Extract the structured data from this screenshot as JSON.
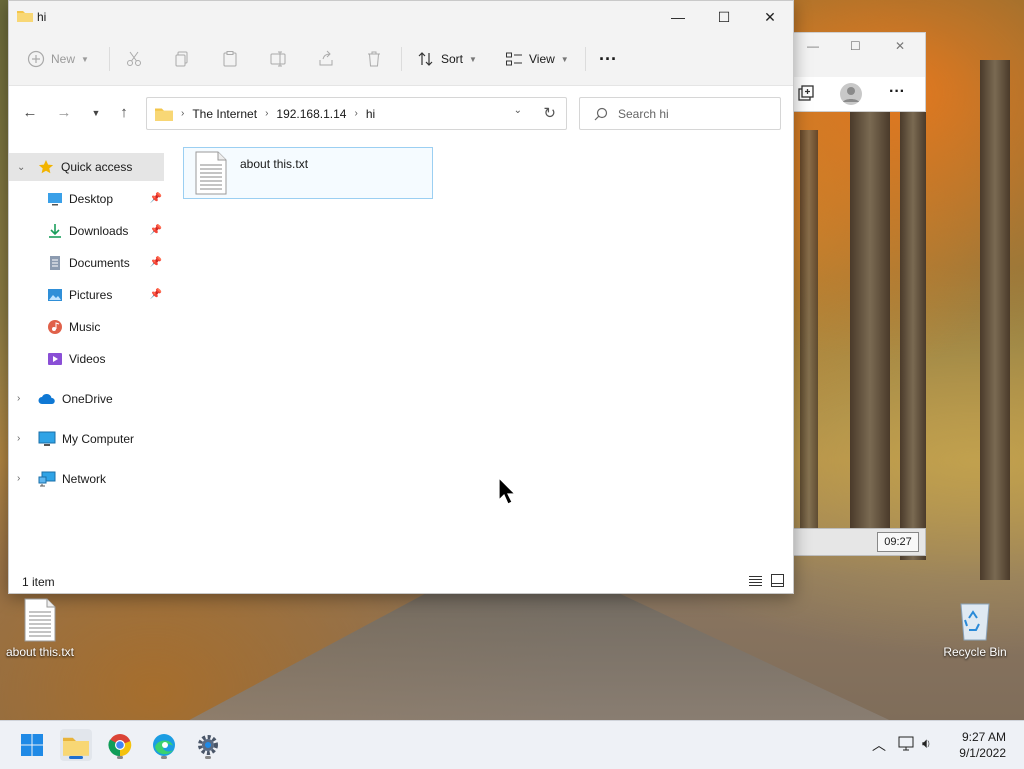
{
  "explorer": {
    "title": "hi",
    "window_controls": {
      "minimize": "—",
      "maximize": "☐",
      "close": "✕"
    },
    "toolbar": {
      "new_label": "New",
      "sort_label": "Sort",
      "view_label": "View",
      "more_label": "···"
    },
    "address": {
      "crumbs": [
        "The Internet",
        "192.168.1.14",
        "hi"
      ]
    },
    "search": {
      "placeholder": "Search hi"
    },
    "sidebar": {
      "quick_access": "Quick access",
      "items": [
        "Desktop",
        "Downloads",
        "Documents",
        "Pictures",
        "Music",
        "Videos"
      ],
      "onedrive": "OneDrive",
      "my_computer": "My Computer",
      "network": "Network"
    },
    "files": [
      {
        "name": "about this.txt"
      }
    ],
    "status": {
      "count": "1 item"
    }
  },
  "background_window": {
    "clock": "09:27"
  },
  "desktop": {
    "icons": [
      {
        "label": "about this.txt"
      },
      {
        "label": "Recycle Bin"
      }
    ]
  },
  "taskbar": {
    "time": "9:27 AM",
    "date": "9/1/2022"
  }
}
